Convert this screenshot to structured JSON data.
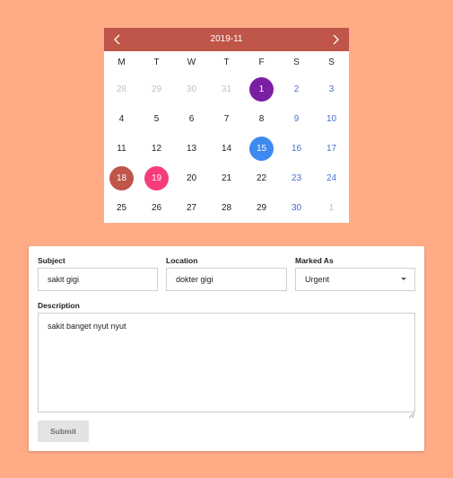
{
  "colors": {
    "page_background": "#FFAB85",
    "calendar_header": "#C0554A",
    "weekend_text": "#4A6FD1",
    "muted_text": "#c2c2c2",
    "today_circle": "#7B1FA2",
    "selected_circle": "#3D8BF0",
    "range_start_circle": "#C0554A",
    "range_end_circle": "#F63C7A"
  },
  "calendar": {
    "title": "2019-11",
    "prev_icon": "chevron-left-icon",
    "next_icon": "chevron-right-icon",
    "weekdays": [
      "M",
      "T",
      "W",
      "T",
      "F",
      "S",
      "S"
    ],
    "weeks": [
      [
        {
          "label": "28",
          "type": "muted"
        },
        {
          "label": "29",
          "type": "muted"
        },
        {
          "label": "30",
          "type": "muted"
        },
        {
          "label": "31",
          "type": "muted"
        },
        {
          "label": "1",
          "type": "circle",
          "color": "#7B1FA2"
        },
        {
          "label": "2",
          "type": "weekend"
        },
        {
          "label": "3",
          "type": "weekend"
        }
      ],
      [
        {
          "label": "4",
          "type": "normal"
        },
        {
          "label": "5",
          "type": "normal"
        },
        {
          "label": "6",
          "type": "normal"
        },
        {
          "label": "7",
          "type": "normal"
        },
        {
          "label": "8",
          "type": "normal"
        },
        {
          "label": "9",
          "type": "weekend"
        },
        {
          "label": "10",
          "type": "weekend"
        }
      ],
      [
        {
          "label": "11",
          "type": "normal"
        },
        {
          "label": "12",
          "type": "normal"
        },
        {
          "label": "13",
          "type": "normal"
        },
        {
          "label": "14",
          "type": "normal"
        },
        {
          "label": "15",
          "type": "circle",
          "color": "#3D8BF0"
        },
        {
          "label": "16",
          "type": "weekend"
        },
        {
          "label": "17",
          "type": "weekend"
        }
      ],
      [
        {
          "label": "18",
          "type": "circle",
          "color": "#C0554A"
        },
        {
          "label": "19",
          "type": "circle",
          "color": "#F63C7A"
        },
        {
          "label": "20",
          "type": "normal"
        },
        {
          "label": "21",
          "type": "normal"
        },
        {
          "label": "22",
          "type": "normal"
        },
        {
          "label": "23",
          "type": "weekend"
        },
        {
          "label": "24",
          "type": "weekend"
        }
      ],
      [
        {
          "label": "25",
          "type": "normal"
        },
        {
          "label": "26",
          "type": "normal"
        },
        {
          "label": "27",
          "type": "normal"
        },
        {
          "label": "28",
          "type": "normal"
        },
        {
          "label": "29",
          "type": "normal"
        },
        {
          "label": "30",
          "type": "weekend"
        },
        {
          "label": "1",
          "type": "muted"
        }
      ]
    ]
  },
  "form": {
    "subject": {
      "label": "Subject",
      "value": "sakit gigi"
    },
    "location": {
      "label": "Location",
      "value": "dokter gigi"
    },
    "marked_as": {
      "label": "Marked As",
      "value": "Urgent"
    },
    "description": {
      "label": "Description",
      "value": "sakit banget nyut nyut"
    },
    "submit_label": "Submit"
  }
}
